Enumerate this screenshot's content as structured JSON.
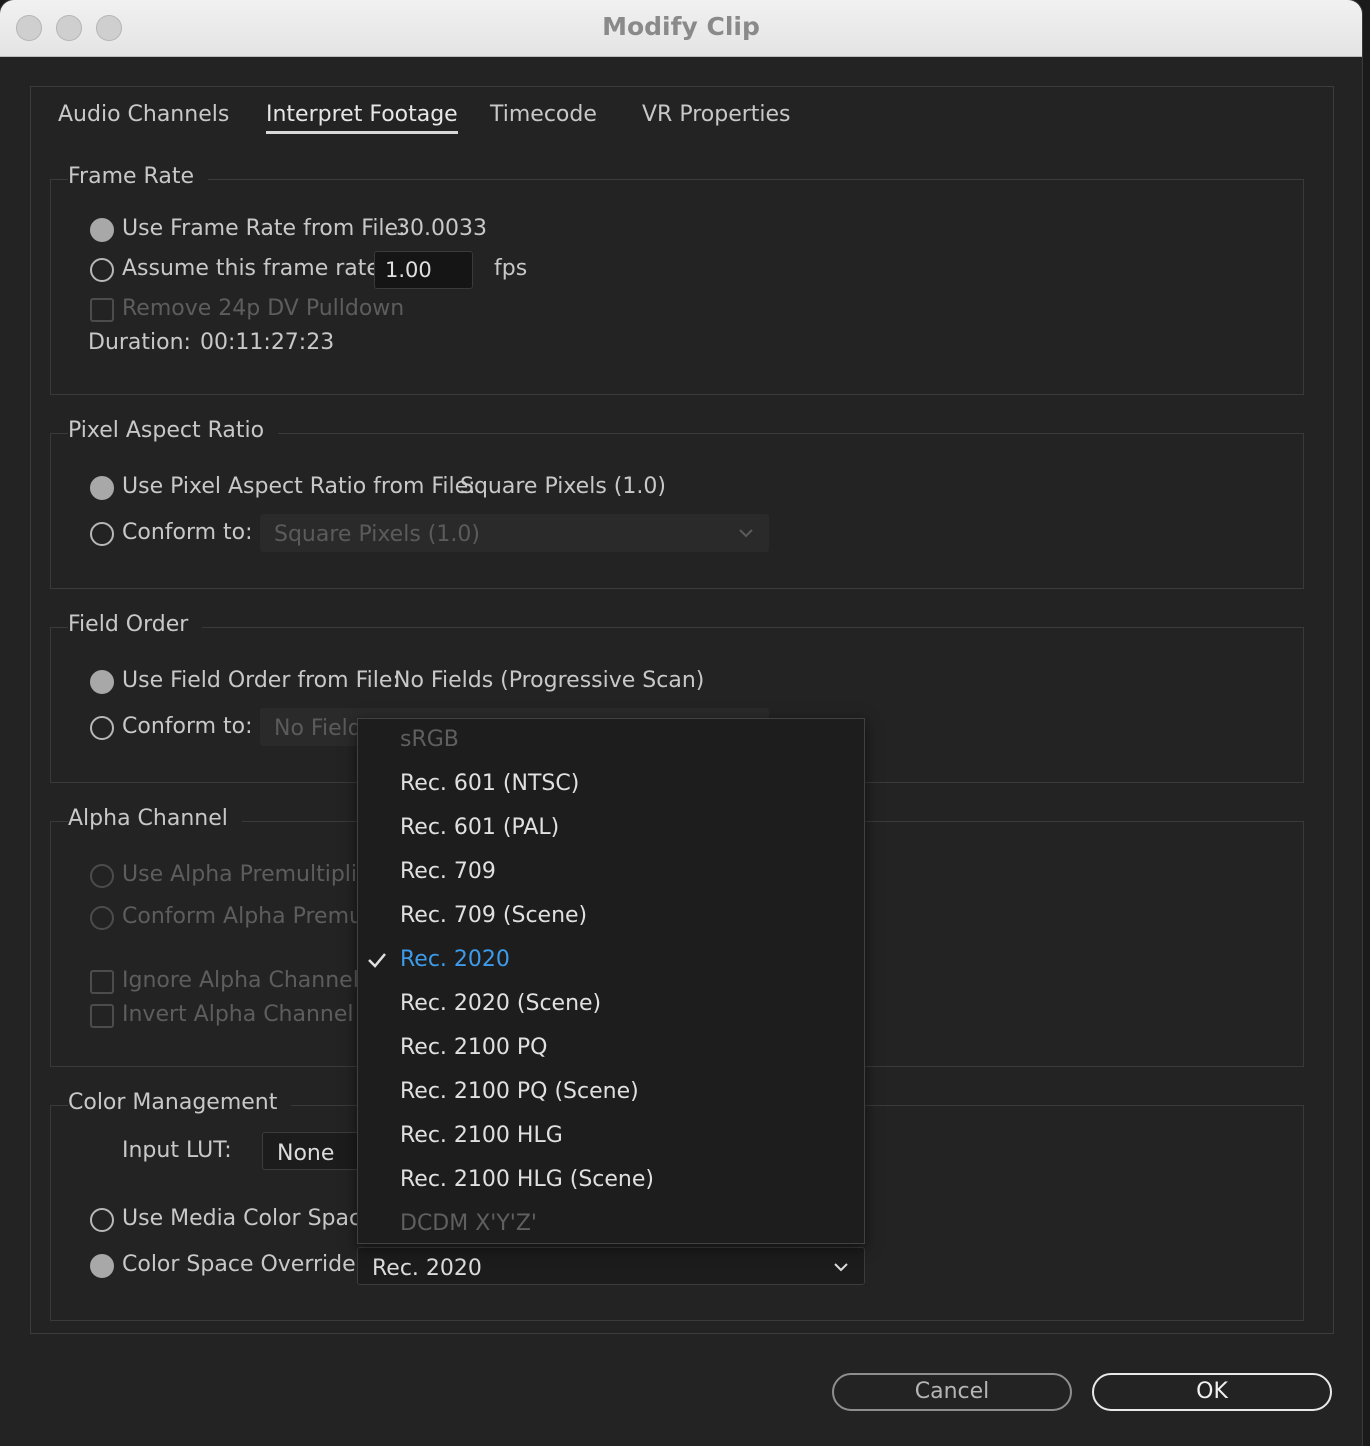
{
  "window": {
    "title": "Modify Clip"
  },
  "tabs": [
    {
      "label": "Audio Channels",
      "active": false
    },
    {
      "label": "Interpret Footage",
      "active": true
    },
    {
      "label": "Timecode",
      "active": false
    },
    {
      "label": "VR Properties",
      "active": false
    }
  ],
  "frame_rate": {
    "label": "Frame Rate",
    "use_from_file_label": "Use Frame Rate from File:",
    "file_value": "30.0033",
    "assume_label": "Assume this frame rate:",
    "assume_value": "1.00",
    "fps_label": "fps",
    "pulldown_label": "Remove 24p DV Pulldown",
    "duration_label": "Duration:",
    "duration_value": "00:11:27:23"
  },
  "pixel_aspect": {
    "label": "Pixel Aspect Ratio",
    "use_from_file_label": "Use Pixel Aspect Ratio from File:",
    "file_value": "Square Pixels (1.0)",
    "conform_label": "Conform to:",
    "conform_value": "Square Pixels (1.0)"
  },
  "field_order": {
    "label": "Field Order",
    "use_from_file_label": "Use Field Order from File:",
    "file_value": "No Fields (Progressive Scan)",
    "conform_label": "Conform to:",
    "conform_value": "No Field"
  },
  "alpha": {
    "label": "Alpha Channel",
    "use_premult_label": "Use Alpha Premultiplica",
    "conform_premult_label": "Conform Alpha Premult",
    "ignore_label": "Ignore Alpha Channel",
    "invert_label": "Invert Alpha Channel"
  },
  "color_mgmt": {
    "label": "Color Management",
    "input_lut_label": "Input LUT:",
    "input_lut_value": "None",
    "use_media_label": "Use Media Color Space f",
    "override_label": "Color Space Override:",
    "override_value": "Rec. 2020"
  },
  "dropdown_menu": {
    "items": [
      {
        "label": "sRGB",
        "state": "disabled"
      },
      {
        "label": "Rec. 601 (NTSC)",
        "state": "normal"
      },
      {
        "label": "Rec. 601 (PAL)",
        "state": "normal"
      },
      {
        "label": "Rec. 709",
        "state": "normal"
      },
      {
        "label": "Rec. 709 (Scene)",
        "state": "normal"
      },
      {
        "label": "Rec. 2020",
        "state": "selected"
      },
      {
        "label": "Rec. 2020 (Scene)",
        "state": "normal"
      },
      {
        "label": "Rec. 2100 PQ",
        "state": "normal"
      },
      {
        "label": "Rec. 2100 PQ (Scene)",
        "state": "normal"
      },
      {
        "label": "Rec. 2100 HLG",
        "state": "normal"
      },
      {
        "label": "Rec. 2100 HLG (Scene)",
        "state": "normal"
      },
      {
        "label": "DCDM X'Y'Z'",
        "state": "disabled"
      }
    ]
  },
  "buttons": {
    "cancel": "Cancel",
    "ok": "OK"
  },
  "colors": {
    "accent": "#3d9be9",
    "background": "#232323",
    "titlebar": "#e8e8e8"
  }
}
